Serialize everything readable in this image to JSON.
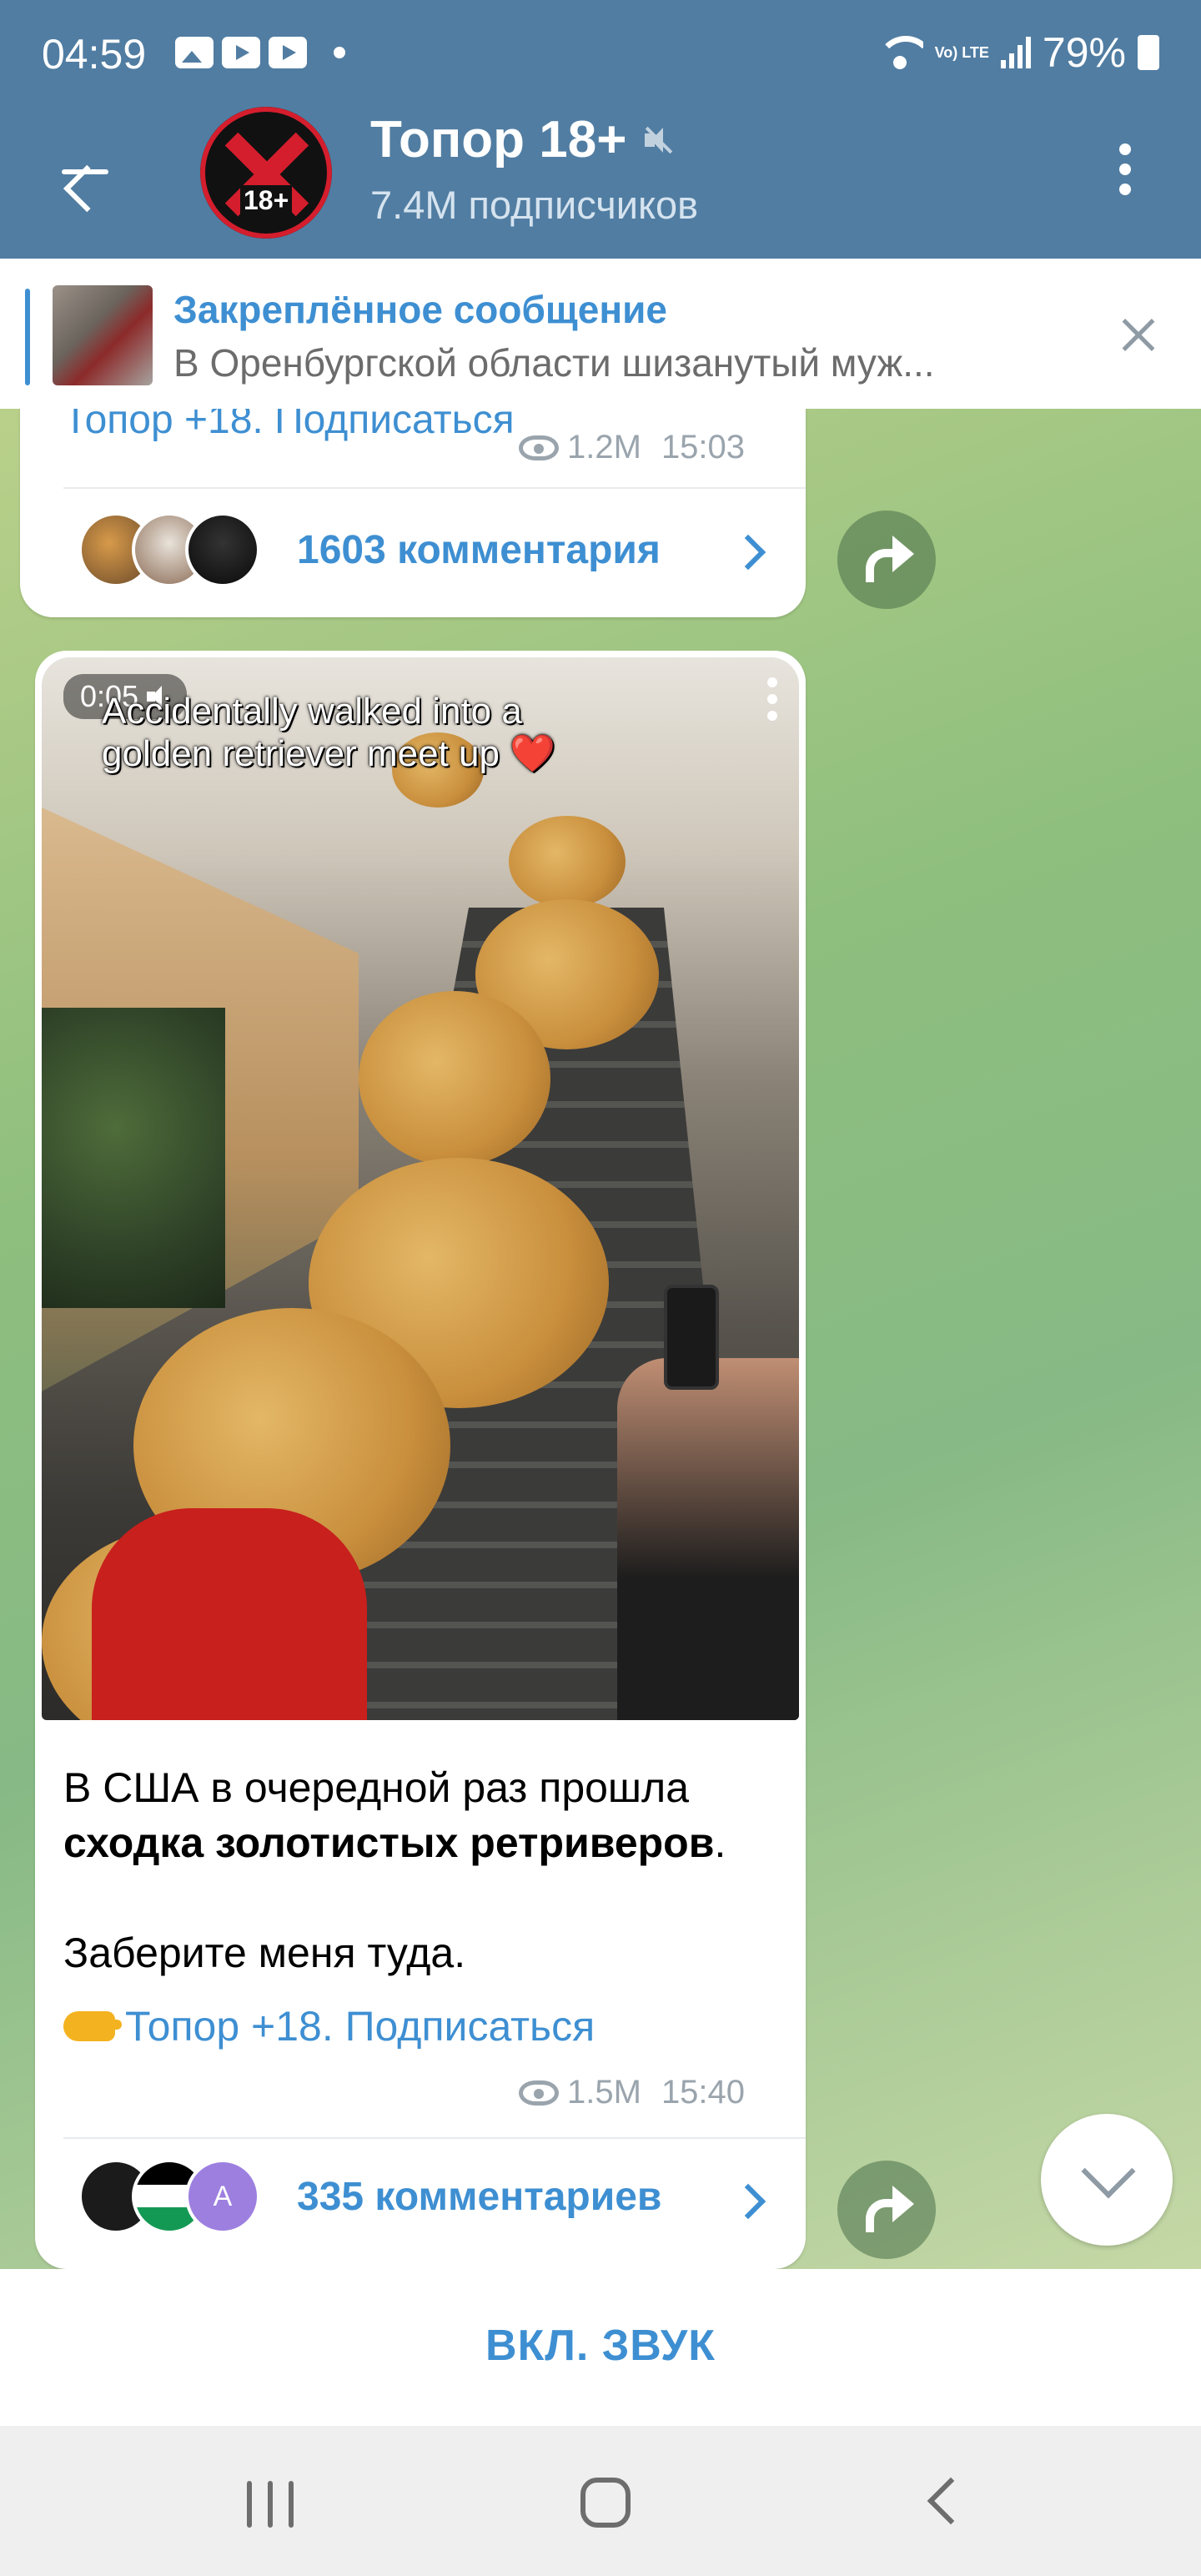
{
  "status_bar": {
    "time": "04:59",
    "lte_label": "Vo) LTE",
    "battery": "79%"
  },
  "header": {
    "channel_name": "Топор 18+",
    "subscribers": "7.4M подписчиков",
    "avatar_badge": "18+"
  },
  "pinned": {
    "title": "Закреплённое сообщение",
    "text": "В Оренбургской области шизанутый муж..."
  },
  "prev_post": {
    "partial_link": "Топор +18. Подписаться",
    "views": "1.2M",
    "time": "15:03",
    "comments": "1603 комментария"
  },
  "post": {
    "video_time": "0:05",
    "video_caption": "Accidentally walked into a golden retriever meet up ❤️",
    "text_line1": "В США в очередной раз прошла",
    "text_bold": "сходка золотистых ретриверов",
    "text_period": ".",
    "text_line3": "Заберите меня туда.",
    "link": "Топор +18. Подписаться",
    "views": "1.5M",
    "time": "15:40",
    "comments": "335 комментариев",
    "commenter_initial": "A"
  },
  "bottom": {
    "unmute_label": "ВКЛ. ЗВУК"
  },
  "colors": {
    "header_bg": "#517da2",
    "accent": "#3e8fd2",
    "meta_gray": "#9aa4ad"
  }
}
